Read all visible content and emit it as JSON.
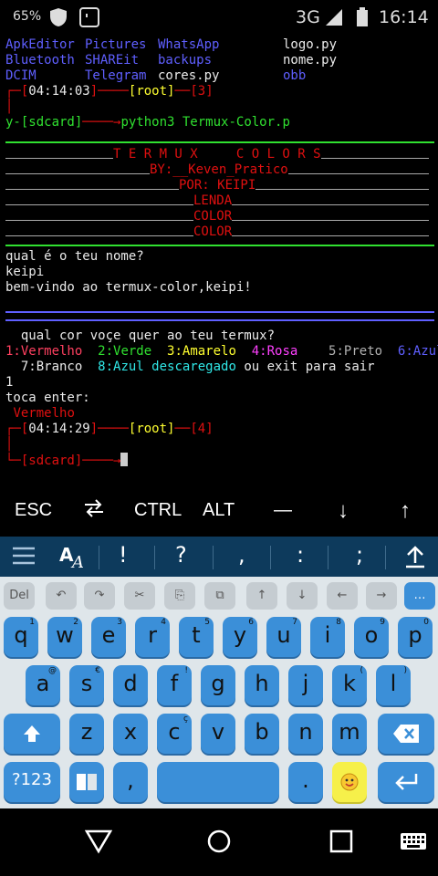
{
  "status_bar": {
    "battery_percent": "65%",
    "network": "3G",
    "time": "16:14"
  },
  "terminal": {
    "ls_rows": [
      [
        "ApkEditor",
        "Pictures",
        "WhatsApp",
        "logo.py"
      ],
      [
        "Bluetooth",
        "SHAREit",
        "backups",
        "nome.py"
      ],
      [
        "DCIM",
        "Telegram",
        "cores.py",
        "obb"
      ]
    ],
    "prompt1": {
      "time": "04:14:03",
      "user": "root",
      "num": "3"
    },
    "cmd_line": {
      "dir": "y-[sdcard]",
      "arrow": "────→",
      "command": "python3 Termux-Color.p"
    },
    "banner": {
      "title": "T E R M U X     C O L O R S",
      "by": "BY:__Keven_Pratico",
      "por": "POR: KEIPI",
      "lenda": "LENDA",
      "color1": "COLOR",
      "color2": "COLOR"
    },
    "question_name": "qual é o teu nome?",
    "answer_name": "keipi",
    "welcome": "bem-vindo ao termux-color,keipi!",
    "question_color": "  qual cor voçe quer ao teu termux?",
    "options": {
      "o1": "1:Vermelho",
      "o2": "2:Verde",
      "o3": "3:Amarelo",
      "o4": "4:Rosa",
      "o5": "5:Preto",
      "o6": "6:Azul",
      "o7": "7:Branco",
      "o8": "8:Azul descaregado",
      "exit_text": "ou exit para sair"
    },
    "answer_color": "1",
    "press_enter": "toca enter:",
    "chosen": "Vermelho",
    "prompt2": {
      "time": "04:14:29",
      "user": "root",
      "num": "4"
    },
    "final_dir": "[sdcard]"
  },
  "extra_keys": {
    "esc": "ESC",
    "tab_icon": "tab-swap-icon",
    "ctrl": "CTRL",
    "alt": "ALT",
    "dash": "—",
    "down": "↓",
    "up": "↑"
  },
  "keyboard_toolbar": {
    "menu_icon": "menu-icon",
    "font_icon": "font-size-icon",
    "k1": "!",
    "k2": "?",
    "k3": ",",
    "k4": ":",
    "k5": ";",
    "upload_icon": "upload-icon"
  },
  "keyboard": {
    "ctl": {
      "del": "Del",
      "undo": "↶",
      "redo": "↷",
      "cut": "✂",
      "copy": "⎘",
      "paste": "⧉",
      "up": "↑",
      "down": "↓",
      "left": "←",
      "right": "→",
      "more": "…"
    },
    "row1": [
      {
        "k": "q",
        "s": "1"
      },
      {
        "k": "w",
        "s": "2"
      },
      {
        "k": "e",
        "s": "3"
      },
      {
        "k": "r",
        "s": "4"
      },
      {
        "k": "t",
        "s": "5"
      },
      {
        "k": "y",
        "s": "6"
      },
      {
        "k": "u",
        "s": "7"
      },
      {
        "k": "i",
        "s": "8"
      },
      {
        "k": "o",
        "s": "9"
      },
      {
        "k": "p",
        "s": "0"
      }
    ],
    "row2": [
      {
        "k": "a",
        "s": "@"
      },
      {
        "k": "s",
        "s": "€"
      },
      {
        "k": "d",
        "s": ""
      },
      {
        "k": "f",
        "s": "!"
      },
      {
        "k": "g",
        "s": ""
      },
      {
        "k": "h",
        "s": ""
      },
      {
        "k": "j",
        "s": ""
      },
      {
        "k": "k",
        "s": "("
      },
      {
        "k": "l",
        "s": ")"
      }
    ],
    "row3": [
      {
        "k": "z",
        "s": ""
      },
      {
        "k": "x",
        "s": ""
      },
      {
        "k": "c",
        "s": "ç"
      },
      {
        "k": "v",
        "s": ""
      },
      {
        "k": "b",
        "s": ""
      },
      {
        "k": "n",
        "s": ""
      },
      {
        "k": "m",
        "s": ""
      }
    ],
    "shift_icon": "shift-icon",
    "backspace_icon": "backspace-icon",
    "numbers": "?123",
    "layout_icon": "keyboard-layout-icon",
    "comma": ",",
    "period": ".",
    "emoji_icon": "emoji-icon",
    "enter_icon": "enter-icon"
  },
  "navbar": {
    "back_icon": "back-icon",
    "home_icon": "home-icon",
    "recents_icon": "recents-icon",
    "keyboard_icon": "keyboard-icon"
  }
}
